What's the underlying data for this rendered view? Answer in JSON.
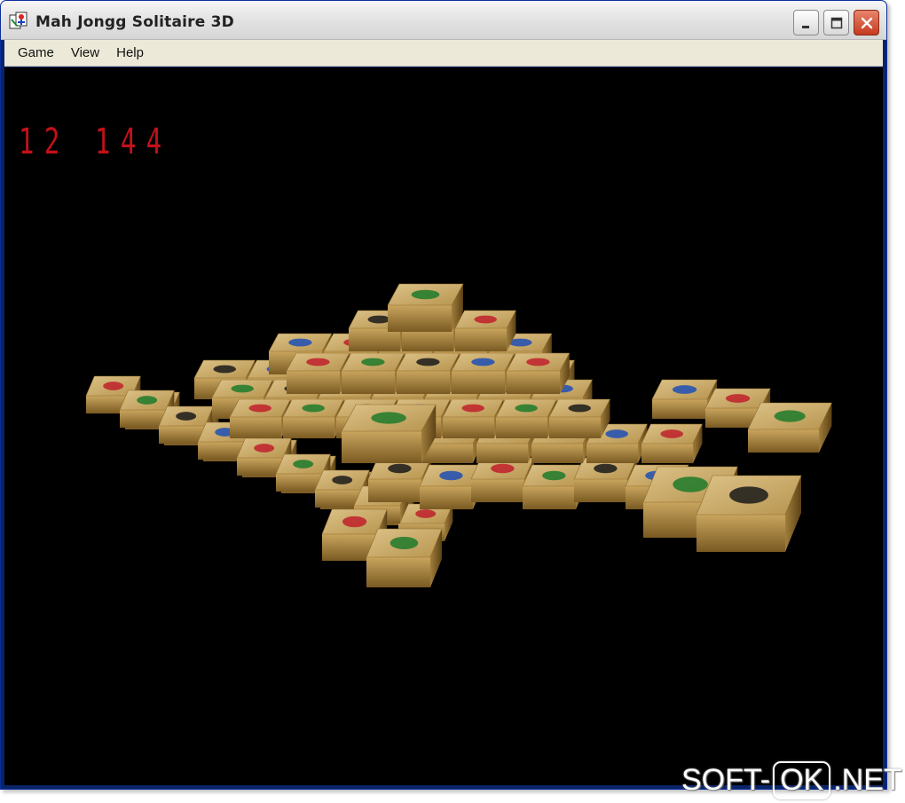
{
  "window": {
    "title": "Mah Jongg Solitaire 3D",
    "controls": {
      "minimize": "minimize",
      "maximize": "maximize",
      "close": "close"
    }
  },
  "menu": [
    "Game",
    "View",
    "Help"
  ],
  "counters": {
    "pairs": "12",
    "tiles": "144"
  },
  "watermark": {
    "left": "SOFT-",
    "box": "OK",
    "right": ".NET"
  },
  "colors": {
    "background": "#000000",
    "counter_text": "#c4101a",
    "tile_face": "#c9a968",
    "tile_side": "#8a6a2c"
  }
}
